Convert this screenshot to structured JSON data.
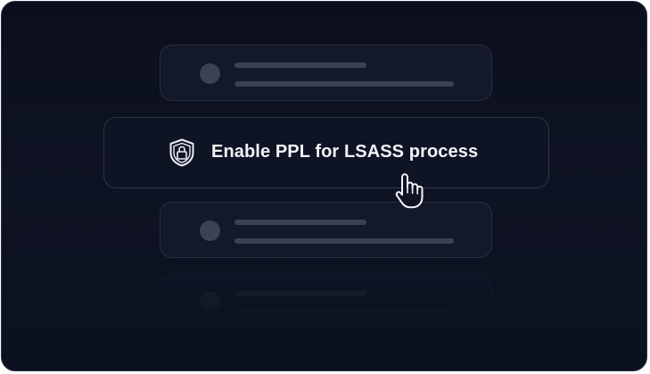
{
  "action": {
    "label": "Enable PPL for LSASS process",
    "icon": "shield-lock-icon"
  },
  "cursor": {
    "icon": "hand-pointer-icon"
  },
  "colors": {
    "background": "#0e1323",
    "card_border": "#2f3546",
    "placeholder": "#3a4150",
    "text": "#f1f3f7"
  }
}
